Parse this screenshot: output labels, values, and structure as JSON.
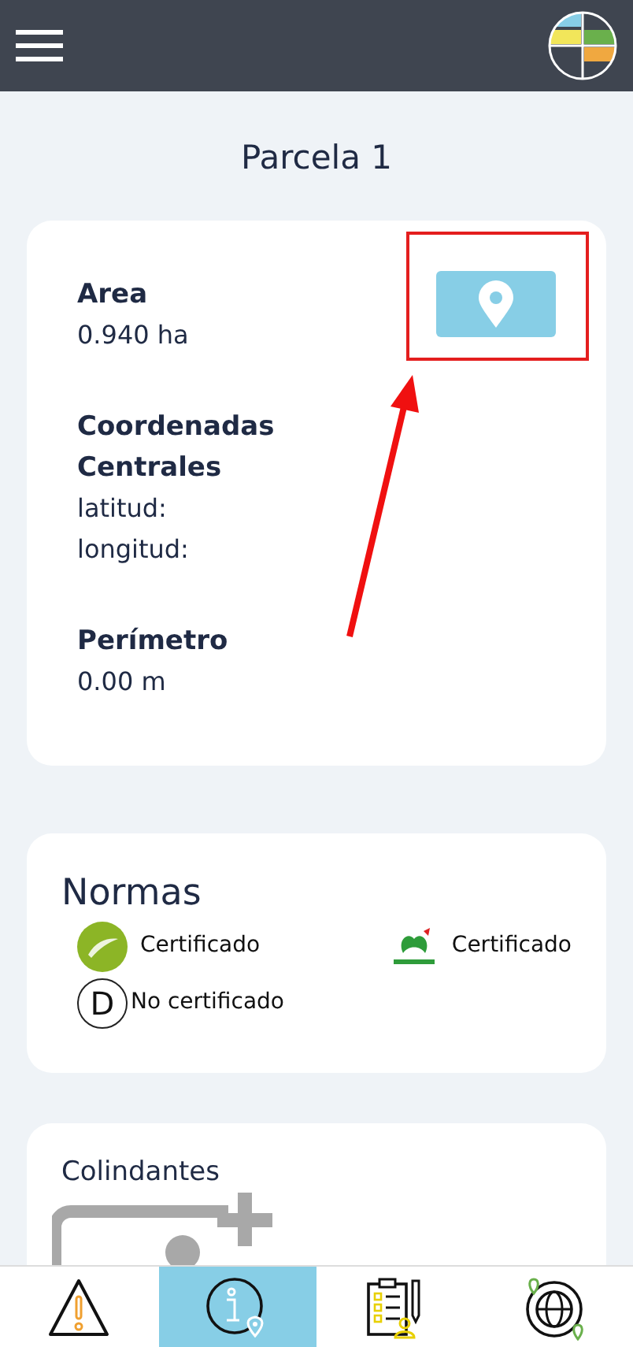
{
  "title": "Parcela 1",
  "parcel_card": {
    "fields": [
      {
        "label": "Area",
        "values": [
          "0.940 ha"
        ]
      },
      {
        "label": "Coordenadas Centrales",
        "values": [
          "latitud:",
          "longitud:"
        ]
      },
      {
        "label": "Perímetro",
        "values": [
          "0.00 m"
        ]
      }
    ]
  },
  "normas": {
    "title": "Normas",
    "items": [
      {
        "kind": "eu-organic",
        "status": "Certificado"
      },
      {
        "kind": "bio-suisse",
        "status": "Certificado"
      },
      {
        "kind": "letter",
        "letter": "D",
        "status": "No certificado"
      }
    ]
  },
  "colindantes": {
    "title": "Colindantes"
  },
  "bottom_nav": [
    {
      "kind": "alerts",
      "selected": false
    },
    {
      "kind": "info",
      "selected": true
    },
    {
      "kind": "checklist",
      "selected": false
    },
    {
      "kind": "globe",
      "selected": false
    }
  ]
}
